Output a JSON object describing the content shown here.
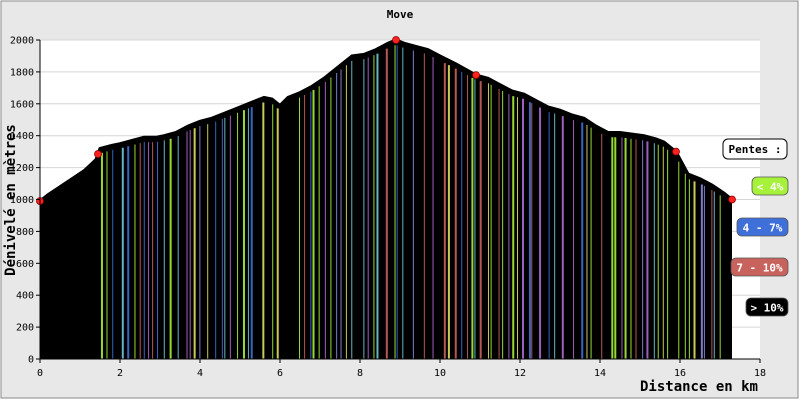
{
  "chart_data": {
    "type": "area",
    "title": "Move",
    "xlabel": "Distance en km",
    "ylabel": "Dénivelé en mètres",
    "xlim": [
      0,
      18
    ],
    "ylim": [
      0,
      2000
    ],
    "x_ticks": [
      "0",
      "2",
      "4",
      "6",
      "8",
      "10",
      "12",
      "14",
      "16",
      "18"
    ],
    "y_ticks": [
      "0",
      "200",
      "400",
      "600",
      "800",
      "1000",
      "1200",
      "1400",
      "1600",
      "1800",
      "2000"
    ],
    "grid": true,
    "legend_title": "Pentes :",
    "legend": [
      {
        "label": "< 4%",
        "color": "#a6f23a",
        "text_color": "#ffffff"
      },
      {
        "label": "4 - 7%",
        "color": "#3f6fd8",
        "text_color": "#ffffff"
      },
      {
        "label": "7 - 10%",
        "color": "#c8625c",
        "text_color": "#ffffff"
      },
      {
        "label": "> 10%",
        "color": "#000000",
        "text_color": "#ffffff"
      }
    ],
    "profile": [
      [
        0,
        990
      ],
      [
        0.2,
        1030
      ],
      [
        0.5,
        1080
      ],
      [
        0.8,
        1130
      ],
      [
        1.1,
        1180
      ],
      [
        1.4,
        1250
      ],
      [
        1.5,
        1320
      ],
      [
        1.8,
        1340
      ],
      [
        2.0,
        1350
      ],
      [
        2.3,
        1370
      ],
      [
        2.6,
        1390
      ],
      [
        2.9,
        1390
      ],
      [
        3.1,
        1400
      ],
      [
        3.4,
        1420
      ],
      [
        3.7,
        1460
      ],
      [
        4.0,
        1490
      ],
      [
        4.3,
        1510
      ],
      [
        4.6,
        1540
      ],
      [
        4.9,
        1570
      ],
      [
        5.2,
        1600
      ],
      [
        5.6,
        1640
      ],
      [
        5.8,
        1630
      ],
      [
        6.0,
        1590
      ],
      [
        6.2,
        1640
      ],
      [
        6.5,
        1670
      ],
      [
        6.8,
        1710
      ],
      [
        7.1,
        1760
      ],
      [
        7.4,
        1820
      ],
      [
        7.8,
        1900
      ],
      [
        8.1,
        1910
      ],
      [
        8.4,
        1940
      ],
      [
        8.7,
        1980
      ],
      [
        8.9,
        2000
      ],
      [
        9.1,
        1980
      ],
      [
        9.4,
        1960
      ],
      [
        9.7,
        1940
      ],
      [
        10.0,
        1900
      ],
      [
        10.4,
        1850
      ],
      [
        10.9,
        1780
      ],
      [
        11.2,
        1760
      ],
      [
        11.5,
        1720
      ],
      [
        11.8,
        1680
      ],
      [
        12.1,
        1660
      ],
      [
        12.4,
        1620
      ],
      [
        12.7,
        1580
      ],
      [
        13.0,
        1560
      ],
      [
        13.3,
        1530
      ],
      [
        13.6,
        1510
      ],
      [
        13.9,
        1460
      ],
      [
        14.2,
        1420
      ],
      [
        14.5,
        1420
      ],
      [
        14.8,
        1410
      ],
      [
        15.1,
        1400
      ],
      [
        15.4,
        1380
      ],
      [
        15.6,
        1360
      ],
      [
        15.9,
        1300
      ],
      [
        16.2,
        1160
      ],
      [
        16.5,
        1130
      ],
      [
        16.8,
        1090
      ],
      [
        17.1,
        1040
      ],
      [
        17.3,
        1000
      ]
    ],
    "markers_x": [
      0,
      1.45,
      8.9,
      10.9,
      15.9,
      17.3
    ]
  }
}
